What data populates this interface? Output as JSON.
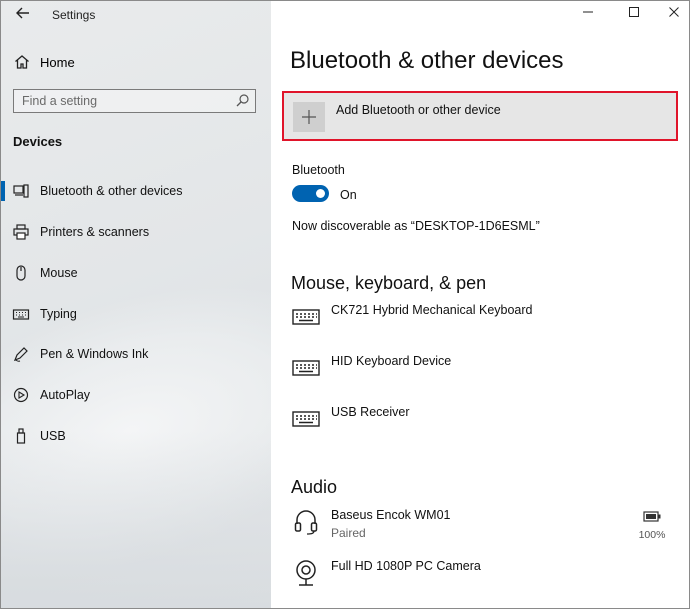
{
  "window": {
    "title": "Settings",
    "controls": {
      "minimize": "—",
      "maximize": "☐",
      "close": "✕"
    }
  },
  "sidebar": {
    "home_label": "Home",
    "search_placeholder": "Find a setting",
    "section_title": "Devices",
    "items": [
      {
        "label": "Bluetooth & other devices",
        "icon": "bluetooth-devices-icon",
        "active": true
      },
      {
        "label": "Printers & scanners",
        "icon": "printer-icon",
        "active": false
      },
      {
        "label": "Mouse",
        "icon": "mouse-icon",
        "active": false
      },
      {
        "label": "Typing",
        "icon": "keyboard-icon",
        "active": false
      },
      {
        "label": "Pen & Windows Ink",
        "icon": "pen-icon",
        "active": false
      },
      {
        "label": "AutoPlay",
        "icon": "autoplay-icon",
        "active": false
      },
      {
        "label": "USB",
        "icon": "usb-icon",
        "active": false
      }
    ]
  },
  "main": {
    "title": "Bluetooth & other devices",
    "add_device_label": "Add Bluetooth or other device",
    "bluetooth": {
      "label": "Bluetooth",
      "state": "On",
      "discoverable_text": "Now discoverable as “DESKTOP-1D6ESML”"
    },
    "mouse_keyboard_pen": {
      "heading": "Mouse, keyboard, & pen",
      "devices": [
        {
          "name": "CK721 Hybrid Mechanical Keyboard",
          "icon": "keyboard-icon"
        },
        {
          "name": "HID Keyboard Device",
          "icon": "keyboard-icon"
        },
        {
          "name": "USB Receiver",
          "icon": "keyboard-icon"
        }
      ]
    },
    "audio": {
      "heading": "Audio",
      "devices": [
        {
          "name": "Baseus Encok WM01",
          "status": "Paired",
          "battery": "100%",
          "icon": "headset-icon"
        },
        {
          "name": "Full HD 1080P PC Camera",
          "icon": "webcam-icon"
        }
      ]
    }
  },
  "colors": {
    "accent": "#0063b1",
    "highlight_border": "#e0142a"
  }
}
